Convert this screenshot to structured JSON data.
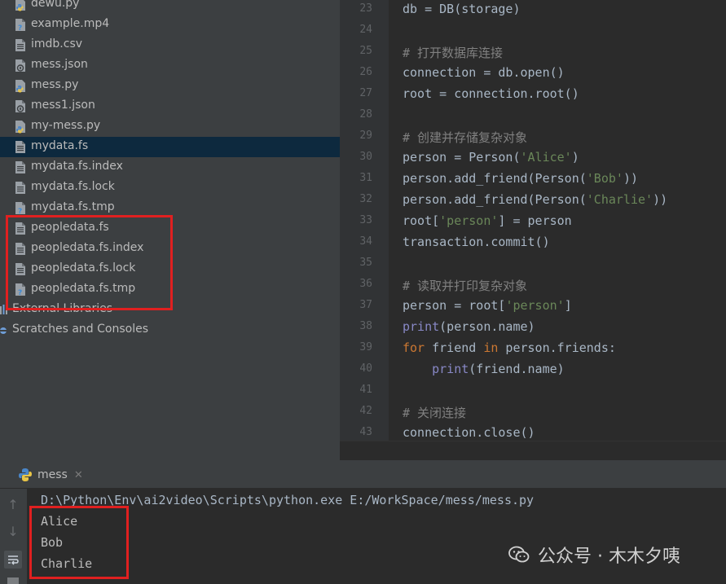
{
  "project": {
    "files": [
      {
        "name": "dewu.py",
        "icon": "python-file-icon"
      },
      {
        "name": "example.mp4",
        "icon": "unknown-file-icon"
      },
      {
        "name": "imdb.csv",
        "icon": "text-file-icon"
      },
      {
        "name": "mess.json",
        "icon": "json-file-icon"
      },
      {
        "name": "mess.py",
        "icon": "python-file-icon"
      },
      {
        "name": "mess1.json",
        "icon": "json-file-icon"
      },
      {
        "name": "my-mess.py",
        "icon": "python-file-icon"
      },
      {
        "name": "mydata.fs",
        "icon": "text-file-icon",
        "selected": true
      },
      {
        "name": "mydata.fs.index",
        "icon": "text-file-icon"
      },
      {
        "name": "mydata.fs.lock",
        "icon": "text-file-icon"
      },
      {
        "name": "mydata.fs.tmp",
        "icon": "unknown-file-icon"
      },
      {
        "name": "peopledata.fs",
        "icon": "text-file-icon"
      },
      {
        "name": "peopledata.fs.index",
        "icon": "text-file-icon"
      },
      {
        "name": "peopledata.fs.lock",
        "icon": "text-file-icon"
      },
      {
        "name": "peopledata.fs.tmp",
        "icon": "unknown-file-icon"
      }
    ],
    "external_libraries": "External Libraries",
    "scratches": "Scratches and Consoles"
  },
  "editor": {
    "lines": [
      {
        "num": "23",
        "text": "db = DB(storage)"
      },
      {
        "num": "24",
        "text": ""
      },
      {
        "num": "25",
        "text": "# 打开数据库连接"
      },
      {
        "num": "26",
        "text": "connection = db.open()"
      },
      {
        "num": "27",
        "text": "root = connection.root()"
      },
      {
        "num": "28",
        "text": ""
      },
      {
        "num": "29",
        "text": "# 创建并存储复杂对象"
      },
      {
        "num": "30",
        "text": "person = Person('Alice')"
      },
      {
        "num": "31",
        "text": "person.add_friend(Person('Bob'))"
      },
      {
        "num": "32",
        "text": "person.add_friend(Person('Charlie'))"
      },
      {
        "num": "33",
        "text": "root['person'] = person"
      },
      {
        "num": "34",
        "text": "transaction.commit()"
      },
      {
        "num": "35",
        "text": ""
      },
      {
        "num": "36",
        "text": "# 读取并打印复杂对象"
      },
      {
        "num": "37",
        "text": "person = root['person']"
      },
      {
        "num": "38",
        "text": "print(person.name)"
      },
      {
        "num": "39",
        "text": "for friend in person.friends:"
      },
      {
        "num": "40",
        "text": "    print(friend.name)"
      },
      {
        "num": "41",
        "text": ""
      },
      {
        "num": "42",
        "text": "# 关闭连接"
      },
      {
        "num": "43",
        "text": "connection.close()"
      }
    ]
  },
  "run": {
    "tab_label": "mess",
    "command": "D:\\Python\\Env\\ai2video\\Scripts\\python.exe E:/WorkSpace/mess/mess.py",
    "output": [
      "Alice",
      "Bob",
      "Charlie"
    ]
  },
  "watermark": {
    "text": "公众号 · 木木夕咦"
  },
  "colors": {
    "keyword": "#cc7832",
    "string": "#6a8759",
    "comment": "#808080",
    "builtin": "#8888c6",
    "highlight_box": "#e02020",
    "selection": "#0d293e"
  }
}
